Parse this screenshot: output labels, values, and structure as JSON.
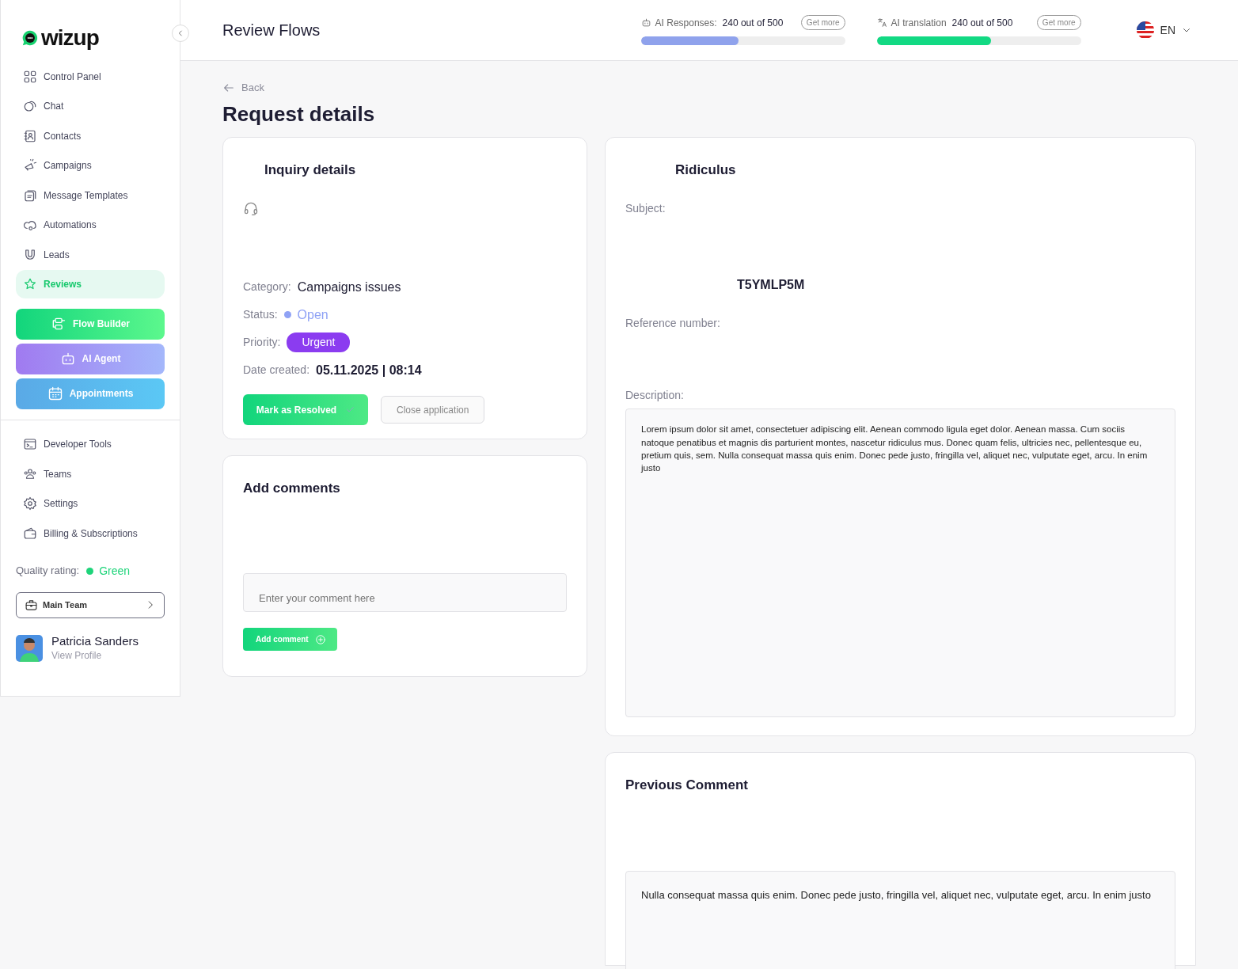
{
  "brand": {
    "name": "wizup"
  },
  "header": {
    "title": "Review Flows",
    "language": "EN",
    "usage": [
      {
        "kind": "responses",
        "label": "AI Responses:",
        "value": "240 out of 500",
        "button": "Get more",
        "level": 0.48,
        "color": "#8fa2ec"
      },
      {
        "kind": "translation",
        "label": "AI translation",
        "value": "240 out of 500",
        "button": "Get more",
        "level": 0.56,
        "color": "#12d983"
      }
    ]
  },
  "sidebar": {
    "items": [
      {
        "label": "Control Panel",
        "selected": false
      },
      {
        "label": "Chat",
        "selected": false
      },
      {
        "label": "Contacts",
        "selected": false
      },
      {
        "label": "Campaigns",
        "selected": false
      },
      {
        "label": "Message Templates",
        "selected": false
      },
      {
        "label": "Automations",
        "selected": false
      },
      {
        "label": "Leads",
        "selected": false
      },
      {
        "label": "Reviews",
        "selected": true
      }
    ],
    "actions": [
      {
        "kind": "flow",
        "label": "Flow Builder"
      },
      {
        "kind": "agent",
        "label": "AI Agent"
      },
      {
        "kind": "appointments",
        "label": "Appointments"
      }
    ],
    "tools": [
      {
        "label": "Developer Tools"
      },
      {
        "label": "Teams"
      },
      {
        "label": "Settings"
      },
      {
        "label": "Billing & Subscriptions"
      }
    ],
    "quality": {
      "label": "Quality rating:",
      "value": "Green",
      "color": "#1ed47a"
    },
    "team": "Main Team",
    "user": {
      "name": "Patricia Sanders",
      "link": "View Profile"
    }
  },
  "back": "Back",
  "page_title": "Request details",
  "inquiry": {
    "title": "Inquiry details",
    "fields": [
      {
        "kind": "text",
        "label": "Category:",
        "value": "Campaigns issues"
      },
      {
        "kind": "status",
        "label": "Status:",
        "value": "Open",
        "color": "#8fa2f5"
      },
      {
        "kind": "badge",
        "label": "Priority:",
        "value": "Urgent"
      },
      {
        "kind": "strong",
        "label": "Date created:",
        "value": "05.11.2025 | 08:14"
      }
    ],
    "resolve_button": "Mark as Resolved",
    "close_button": "Close application"
  },
  "comments": {
    "title": "Add comments",
    "placeholder": "Enter your comment here",
    "button": "Add comment"
  },
  "request": {
    "title": "Ridiculus",
    "subject_label": "Subject:",
    "code": "T5YMLP5M",
    "reference_label": "Reference number:",
    "description_label": "Description:",
    "description": "Lorem ipsum dolor sit amet, consectetuer adipiscing elit. Aenean commodo ligula eget dolor. Aenean massa. Cum sociis natoque penatibus et magnis dis parturient montes, nascetur ridiculus mus. Donec quam felis, ultricies nec, pellentesque eu, pretium quis, sem. Nulla consequat massa quis enim. Donec pede justo, fringilla vel, aliquet nec, vulputate eget, arcu. In enim justo"
  },
  "previous": {
    "title": "Previous Comment",
    "text": "Nulla consequat massa quis enim. Donec pede justo, fringilla vel, aliquet nec, vulputate eget, arcu. In enim justo"
  }
}
